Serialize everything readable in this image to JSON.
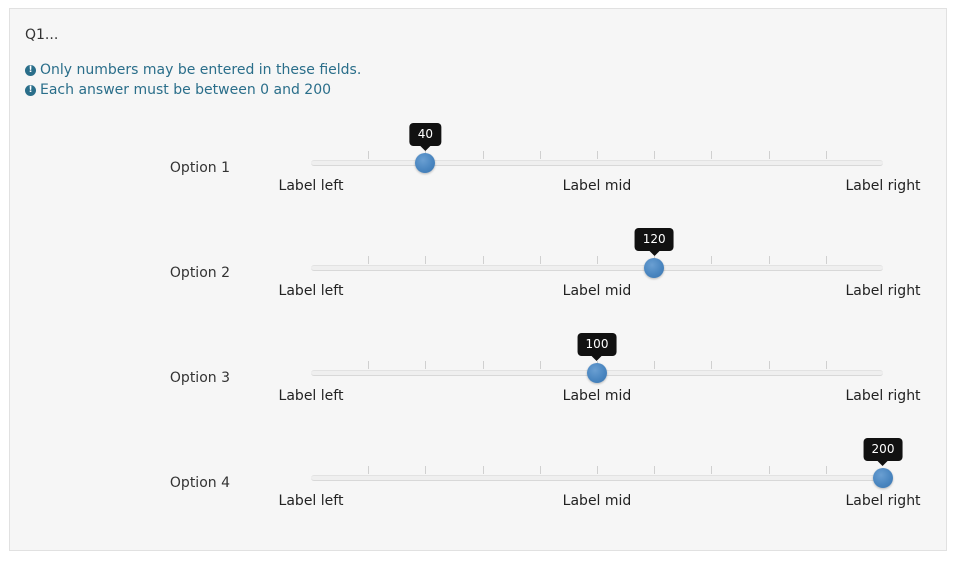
{
  "question": {
    "title": "Q1...",
    "tips": [
      "Only numbers may be entered in these fields.",
      "Each answer must be between 0 and 200"
    ]
  },
  "slider": {
    "min": 0,
    "max": 200,
    "tick_count": 11,
    "labels": {
      "left": "Label left",
      "mid": "Label mid",
      "right": "Label right"
    }
  },
  "options": [
    {
      "label": "Option 1",
      "value": 40
    },
    {
      "label": "Option 2",
      "value": 120
    },
    {
      "label": "Option 3",
      "value": 100
    },
    {
      "label": "Option 4",
      "value": 200
    }
  ],
  "colors": {
    "tip_text": "#2a6e8a",
    "handle": "#4a86c0",
    "bubble": "#111111"
  }
}
